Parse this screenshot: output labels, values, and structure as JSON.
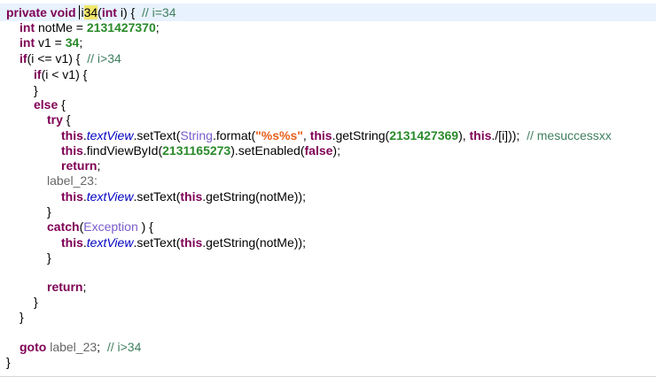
{
  "code": {
    "l1": {
      "kw_private_void": "private void ",
      "name_prefix": "i",
      "name_hl": "34",
      "paren_open": "(",
      "kw_int": "int",
      "params_rest": " i) {  ",
      "comment": "// i=34"
    },
    "l2": {
      "kw": "int",
      "text": " notMe = ",
      "num": "2131427370",
      "end": ";"
    },
    "l3": {
      "kw": "int",
      "text": " v1 = ",
      "num": "34",
      "end": ";"
    },
    "l4": {
      "kw": "if",
      "text": "(i <= v1) {  ",
      "comment": "// i>34"
    },
    "l5": {
      "kw": "if",
      "text": "(i < v1) {"
    },
    "l6": {
      "text": "}"
    },
    "l7": {
      "kw": "else",
      "text": " {"
    },
    "l8": {
      "kw": "try",
      "text": " {"
    },
    "l9": {
      "kw_this1": "this",
      "dot1": ".",
      "field": "textView",
      "method1": ".setText(",
      "cls": "String",
      "method2": ".format(",
      "str": "\"%s%s\"",
      "comma1": ", ",
      "kw_this2": "this",
      "method3": ".getString(",
      "num": "2131427369",
      "mid": "), ",
      "kw_this3": "this",
      "tail": "./[i]));  ",
      "comment": "// mesuccessxx"
    },
    "l10": {
      "kw_this": "this",
      "method": ".findViewById(",
      "num": "2131165273",
      "mid": ").setEnabled(",
      "kw_false": "false",
      "end": ");"
    },
    "l11": {
      "kw": "return",
      "end": ";"
    },
    "l12": {
      "label": "label_23:"
    },
    "l13": {
      "kw_this1": "this",
      "dot": ".",
      "field": "textView",
      "mid": ".setText(",
      "kw_this2": "this",
      "end": ".getString(notMe));"
    },
    "l14": {
      "text": "}"
    },
    "l15": {
      "kw": "catch",
      "paren": "(",
      "cls": "Exception",
      "end": " ) {"
    },
    "l16": {
      "kw_this1": "this",
      "dot": ".",
      "field": "textView",
      "mid": ".setText(",
      "kw_this2": "this",
      "end": ".getString(notMe));"
    },
    "l17": {
      "text": "}"
    },
    "l18": {
      "kw": "return",
      "end": ";"
    },
    "l19": {
      "text": "}"
    },
    "l20": {
      "text": "}"
    },
    "l21": {
      "kw": "goto",
      "label": " label_23",
      "end": ";  ",
      "comment": "// i>34"
    },
    "l22": {
      "text": "}"
    }
  }
}
